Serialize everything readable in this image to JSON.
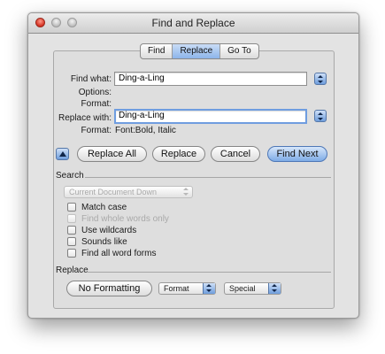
{
  "window": {
    "title": "Find and Replace"
  },
  "tabs": [
    {
      "label": "Find"
    },
    {
      "label": "Replace"
    },
    {
      "label": "Go To"
    }
  ],
  "find": {
    "label": "Find what:",
    "value": "Ding-a-Ling",
    "options_label": "Options:",
    "format_label": "Format:"
  },
  "replace": {
    "label": "Replace with:",
    "value": "Ding-a-Ling",
    "format_label": "Format:",
    "format_value": "Font:Bold, Italic"
  },
  "buttons": {
    "replace_all": "Replace All",
    "replace": "Replace",
    "cancel": "Cancel",
    "find_next": "Find Next"
  },
  "search": {
    "heading": "Search",
    "direction": "Current Document Down",
    "options": [
      {
        "label": "Match case",
        "enabled": true
      },
      {
        "label": "Find whole words only",
        "enabled": false
      },
      {
        "label": "Use wildcards",
        "enabled": true
      },
      {
        "label": "Sounds like",
        "enabled": true
      },
      {
        "label": "Find all word forms",
        "enabled": true
      }
    ]
  },
  "replace_section": {
    "heading": "Replace",
    "no_formatting": "No Formatting",
    "format_menu": "Format",
    "special_menu": "Special"
  }
}
